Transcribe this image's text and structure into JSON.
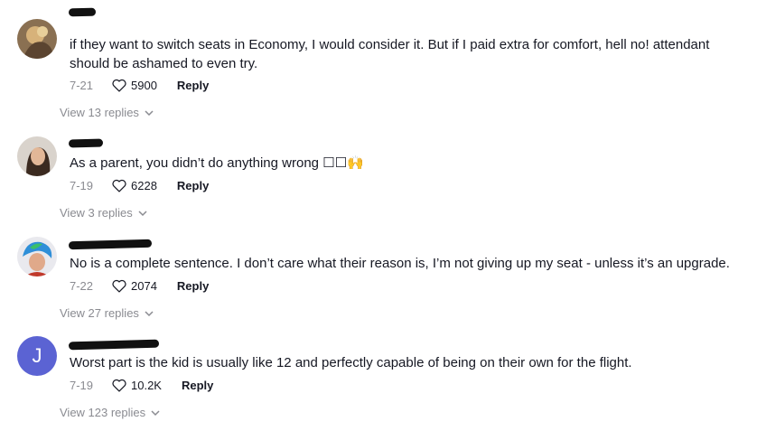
{
  "comments": [
    {
      "avatar": "photo",
      "text": "if they want to switch seats in Economy, I would consider it. But if I paid extra for comfort, hell no! attendant",
      "text2": "should be ashamed to even try.",
      "date": "7-21",
      "likes": "5900",
      "reply": "Reply",
      "view": "View 13 replies"
    },
    {
      "avatar": "photo",
      "text": "As a parent, you didn’t do anything wrong ☐☐🙌",
      "date": "7-19",
      "likes": "6228",
      "reply": "Reply",
      "view": "View 3 replies"
    },
    {
      "avatar": "photo",
      "text": "No is a complete sentence. I don’t care what their reason is, I’m not giving up my seat - unless it’s an upgrade.",
      "date": "7-22",
      "likes": "2074",
      "reply": "Reply",
      "view": "View 27 replies"
    },
    {
      "avatar_letter": "J",
      "avatar_color": "#5b63d3",
      "text": "Worst part is the kid is usually like 12 and perfectly capable of being on their own for the flight.",
      "date": "7-19",
      "likes": "10.2K",
      "reply": "Reply",
      "view": "View 123 replies"
    }
  ],
  "icons": {
    "like": "heart-outline-icon",
    "expand": "chevron-down-icon"
  }
}
